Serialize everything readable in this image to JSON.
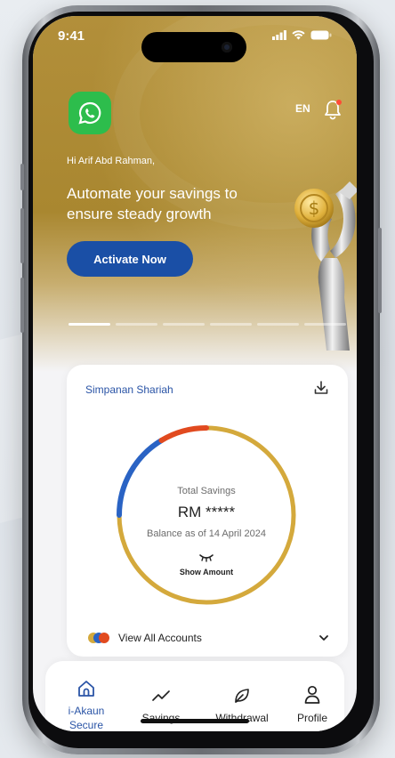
{
  "status": {
    "time": "9:41"
  },
  "header": {
    "language": "EN"
  },
  "hero": {
    "greeting": "Hi Arif Abd Rahman,",
    "tagline": "Automate your savings to ensure steady growth",
    "cta_label": "Activate Now",
    "slides": 6,
    "active_slide": 1
  },
  "account": {
    "name": "Simpanan Shariah",
    "total_label": "Total Savings",
    "amount": "RM *****",
    "balance_date": "Balance as of 14 April 2024",
    "show_label": "Show Amount",
    "view_all_label": "View All Accounts"
  },
  "nav": {
    "items": [
      {
        "label": "i-Akaun Secure",
        "icon": "home-icon",
        "active": true
      },
      {
        "label": "Savings",
        "icon": "trend-icon",
        "active": false
      },
      {
        "label": "Withdrawal",
        "icon": "leaf-icon",
        "active": false
      },
      {
        "label": "Profile",
        "icon": "person-icon",
        "active": false
      }
    ]
  },
  "colors": {
    "brand_blue": "#1a4fa6",
    "gold": "#d4a93c",
    "ring_blue": "#2a63c4",
    "ring_orange": "#e14a1f",
    "whatsapp_green": "#2dbd4c"
  }
}
